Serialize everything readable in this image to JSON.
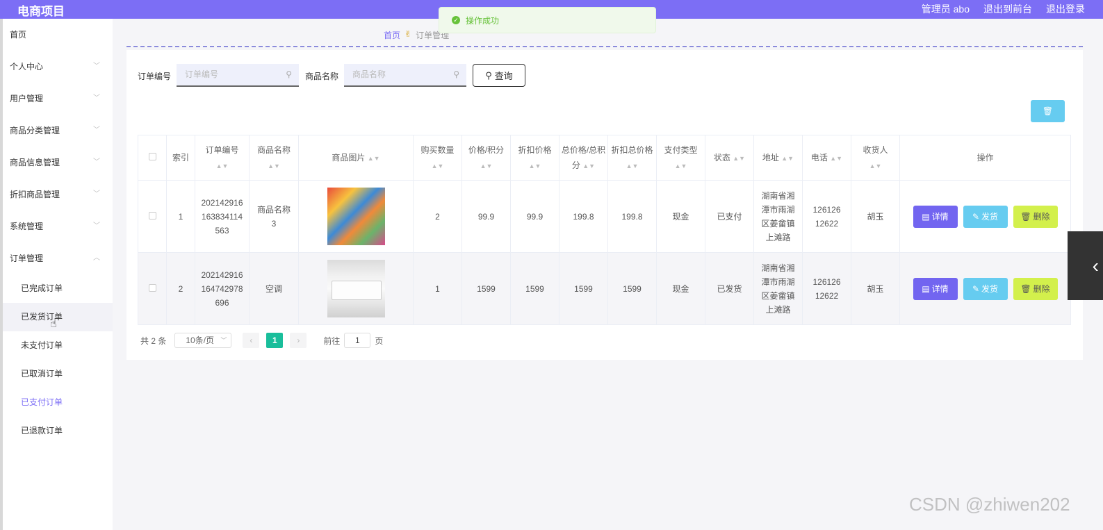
{
  "header": {
    "brand": "电商项目",
    "admin": "管理员 abo",
    "to_front": "退出到前台",
    "logout": "退出登录"
  },
  "toast": {
    "message": "操作成功"
  },
  "sidebar": {
    "items": [
      {
        "label": "首页"
      },
      {
        "label": "个人中心"
      },
      {
        "label": "用户管理"
      },
      {
        "label": "商品分类管理"
      },
      {
        "label": "商品信息管理"
      },
      {
        "label": "折扣商品管理"
      },
      {
        "label": "系统管理"
      },
      {
        "label": "订单管理"
      }
    ],
    "sub_items": [
      {
        "label": "已完成订单"
      },
      {
        "label": "已发货订单"
      },
      {
        "label": "未支付订单"
      },
      {
        "label": "已取消订单"
      },
      {
        "label": "已支付订单"
      },
      {
        "label": "已退款订单"
      }
    ]
  },
  "breadcrumb": {
    "home": "首页",
    "current": "订单管理"
  },
  "search": {
    "order_no_label": "订单编号",
    "order_no_placeholder": "订单编号",
    "product_label": "商品名称",
    "product_placeholder": "商品名称",
    "query_button": "查询"
  },
  "table": {
    "headers": [
      "索引",
      "订单编号",
      "商品名称",
      "商品图片",
      "购买数量",
      "价格/积分",
      "折扣价格",
      "总价格/总积分",
      "折扣总价格",
      "支付类型",
      "状态",
      "地址",
      "电话",
      "收货人",
      "操作"
    ],
    "rows": [
      {
        "index": "1",
        "order_no": "202142916163834114563",
        "product": "商品名称3",
        "qty": "2",
        "price": "99.9",
        "discount_price": "99.9",
        "total": "199.8",
        "discount_total": "199.8",
        "pay_type": "现金",
        "status": "已支付",
        "address": "湖南省湘潭市雨湖区姜畲镇上滩路",
        "phone": "12612612622",
        "receiver": "胡玉"
      },
      {
        "index": "2",
        "order_no": "202142916164742978696",
        "product": "空调",
        "qty": "1",
        "price": "1599",
        "discount_price": "1599",
        "total": "1599",
        "discount_total": "1599",
        "pay_type": "现金",
        "status": "已发货",
        "address": "湖南省湘潭市雨湖区姜畲镇上滩路",
        "phone": "12612612622",
        "receiver": "胡玉"
      }
    ],
    "actions": {
      "detail": "详情",
      "ship": "发货",
      "delete": "删除"
    }
  },
  "pagination": {
    "total": "共 2 条",
    "page_size": "10条/页",
    "current_page": "1",
    "goto_prefix": "前往",
    "goto_value": "1",
    "goto_suffix": "页"
  },
  "watermark": "CSDN @zhiwen202",
  "colors": {
    "primary": "#7c6ef5",
    "ship": "#66ccf0",
    "delete": "#d3f04c",
    "success": "#67c23a"
  }
}
